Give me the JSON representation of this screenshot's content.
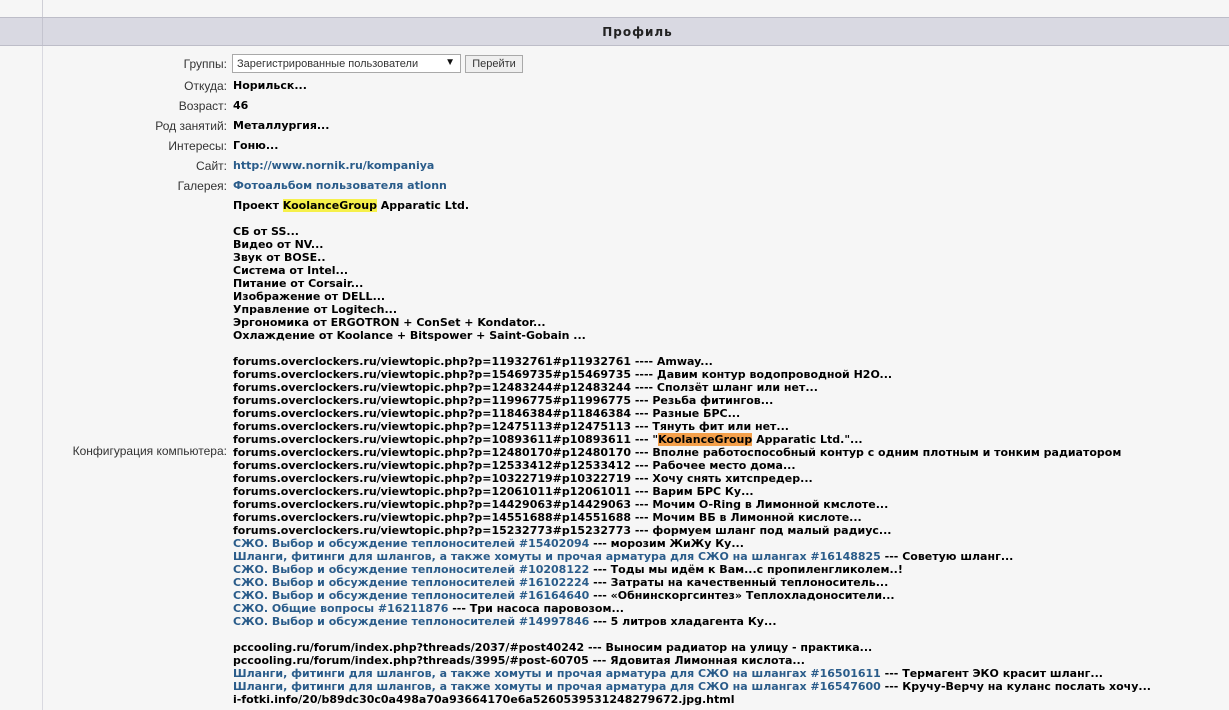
{
  "header": {
    "title": "Профиль"
  },
  "fields": {
    "groups": {
      "label": "Группы:",
      "selected": "Зарегистрированные пользователи",
      "button": "Перейти"
    },
    "location": {
      "label": "Откуда:",
      "value": "Норильск..."
    },
    "age": {
      "label": "Возраст:",
      "value": "46"
    },
    "occupation": {
      "label": "Род занятий:",
      "value": "Металлургия..."
    },
    "interests": {
      "label": "Интересы:",
      "value": "Гоню..."
    },
    "website": {
      "label": "Сайт:",
      "value": "http://www.nornik.ru/kompaniya"
    },
    "gallery": {
      "label": "Галерея:",
      "value": "Фотоальбом пользователя atlonn"
    },
    "config": {
      "label": "Конфигурация компьютера:"
    }
  },
  "signature": {
    "project": {
      "before": "Проект ",
      "highlight": "KoolanceGroup",
      "after": " Apparatic Ltd."
    },
    "components": [
      "СБ от SS...",
      "Видео от NV...",
      "Звук от BOSE..",
      "Система от Intel...",
      "Питание от Corsair...",
      "Изображение от DELL...",
      "Управление от Logitech...",
      "Эргономика от ERGOTRON + ConSet + Kondator...",
      "Охлаждение от Koolance + Bitspower + Saint-Gobain ..."
    ],
    "oc_links": [
      "forums.overclockers.ru/viewtopic.php?p=11932761#p11932761 ---- Amway...",
      "forums.overclockers.ru/viewtopic.php?p=15469735#p15469735 ---- Давим контур водопроводной H2O...",
      "forums.overclockers.ru/viewtopic.php?p=12483244#p12483244 ---- Сползёт шланг или нет...",
      "forums.overclockers.ru/viewtopic.php?p=11996775#p11996775 --- Резьба фитингов...",
      "forums.overclockers.ru/viewtopic.php?p=11846384#p11846384 --- Разные БРС...",
      "forums.overclockers.ru/viewtopic.php?p=12475113#p12475113 --- Тянуть фит или нет...",
      "forums.overclockers.ru/viewtopic.php?p=12480170#p12480170 --- Вполне работоспособный контур с одним плотным и тонким радиатором",
      "forums.overclockers.ru/viewtopic.php?p=12533412#p12533412 --- Рабочее место дома...",
      "forums.overclockers.ru/viewtopic.php?p=10322719#p10322719 --- Хочу снять хитспредер...",
      "forums.overclockers.ru/viewtopic.php?p=12061011#p12061011 --- Варим БРС Ку...",
      "forums.overclockers.ru/viewtopic.php?p=14429063#p14429063 --- Мочим O-Ring в Лимонной кмслоте...",
      "forums.overclockers.ru/viewtopic.php?p=14551688#p14551688 --- Мочим ВБ в Лимонной кислоте...",
      "forums.overclockers.ru/viewtopic.php?p=15232773#p15232773 --- формуем шланг под малый радиус..."
    ],
    "koolance_link": {
      "before": "forums.overclockers.ru/viewtopic.php?p=10893611#p10893611 --- \"",
      "highlight": "KoolanceGroup",
      "after": " Apparatic Ltd.\"..."
    },
    "forum_links": [
      {
        "link": "СЖО. Выбор и обсуждение теплоносителей #15402094",
        "text": " --- морозим ЖиЖу Ку..."
      },
      {
        "link": "Шланги, фитинги для шлангов, а также хомуты и прочая арматура для СЖО на шлангах #16148825",
        "text": " --- Советую шланг..."
      },
      {
        "link": "СЖО. Выбор и обсуждение теплоносителей #10208122",
        "text": " --- Тоды мы идём к Вам...с пропиленгликолем..!"
      },
      {
        "link": "СЖО. Выбор и обсуждение теплоносителей #16102224",
        "text": " --- Затраты на качественный теплоноситель..."
      },
      {
        "link": "СЖО. Выбор и обсуждение теплоносителей #16164640",
        "text": " --- «Обнинскоргсинтез» Теплохладоносители..."
      },
      {
        "link": "СЖО. Общие вопросы #16211876",
        "text": " --- Три насоса паровозом..."
      },
      {
        "link": "СЖО. Выбор и обсуждение теплоносителей #14997846",
        "text": " --- 5 литров хладагента Ку..."
      }
    ],
    "pc_links": [
      "pccooling.ru/forum/index.php?threads/2037/#post40242 --- Выносим радиатор на улицу - практика...",
      "pccooling.ru/forum/index.php?threads/3995/#post-60705 --- Ядовитая Лимонная кислота..."
    ],
    "pc_forum_links": [
      {
        "link": "Шланги, фитинги для шлангов, а также хомуты и прочая арматура для СЖО на шлангах #16501611",
        "text": " --- Термагент ЭКО красит шланг..."
      },
      {
        "link": "Шланги, фитинги для шлангов, а также хомуты и прочая арматура для СЖО на шлангах #16547600",
        "text": " --- Кручу-Верчу на куланс послать хочу..."
      }
    ],
    "last_line": "i-fotki.info/20/b89dc30c0a498a70a93664170e6a5260539531248279672.jpg.html"
  }
}
